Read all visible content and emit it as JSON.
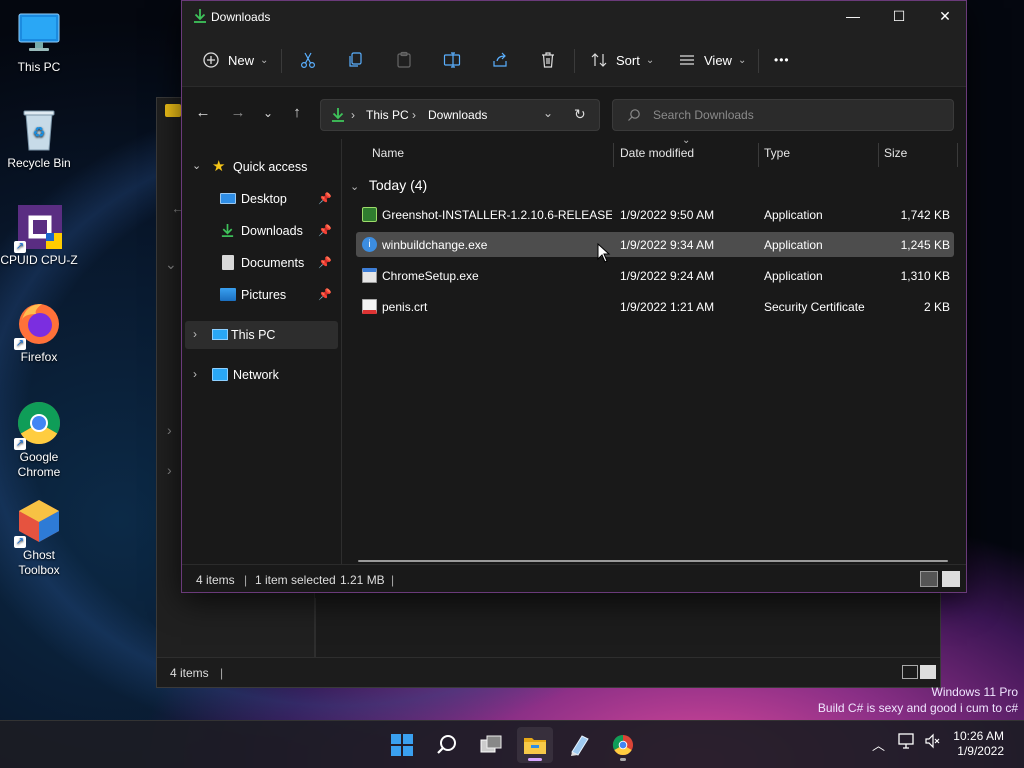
{
  "desktop": {
    "icons": [
      {
        "label": "This PC"
      },
      {
        "label": "Recycle Bin"
      },
      {
        "label": "CPUID CPU-Z"
      },
      {
        "label": "Firefox"
      },
      {
        "label": "Google Chrome"
      },
      {
        "label": "Ghost Toolbox"
      }
    ],
    "watermark": {
      "line1": "Windows 11 Pro",
      "line2": "Build C# is sexy and good i cum to c#"
    }
  },
  "background_window": {
    "status_text": "4 items"
  },
  "window": {
    "title": "Downloads",
    "controls": {
      "minimize": "—",
      "maximize": "☐",
      "close": "✕"
    },
    "toolbar": {
      "new_label": "New",
      "sort_label": "Sort",
      "view_label": "View",
      "more_label": "•••"
    },
    "address": {
      "segments": [
        "This PC",
        "Downloads"
      ],
      "separator": "›"
    },
    "search": {
      "placeholder": "Search Downloads"
    },
    "nav": {
      "quick_access": "Quick access",
      "items": [
        {
          "label": "Desktop"
        },
        {
          "label": "Downloads"
        },
        {
          "label": "Documents"
        },
        {
          "label": "Pictures"
        }
      ],
      "this_pc": "This PC",
      "network": "Network"
    },
    "columns": {
      "name": "Name",
      "date": "Date modified",
      "type": "Type",
      "size": "Size"
    },
    "group_label": "Today (4)",
    "files": [
      {
        "name": "Greenshot-INSTALLER-1.2.10.6-RELEASE....",
        "date": "1/9/2022 9:50 AM",
        "type": "Application",
        "size": "1,742 KB"
      },
      {
        "name": "winbuildchange.exe",
        "date": "1/9/2022 9:34 AM",
        "type": "Application",
        "size": "1,245 KB"
      },
      {
        "name": "ChromeSetup.exe",
        "date": "1/9/2022 9:24 AM",
        "type": "Application",
        "size": "1,310 KB"
      },
      {
        "name": "penis.crt",
        "date": "1/9/2022 1:21 AM",
        "type": "Security Certificate",
        "size": "2 KB"
      }
    ],
    "status": {
      "count": "4 items",
      "selected": "1 item selected",
      "selected_size": "1.21 MB"
    }
  },
  "taskbar": {
    "clock_time": "10:26 AM",
    "clock_date": "1/9/2022",
    "icons": [
      "windows-start-icon",
      "search-icon",
      "task-view-icon",
      "file-explorer-icon",
      "notepad-icon",
      "chrome-icon"
    ]
  },
  "colors": {
    "accent": "#0078d4",
    "selection": "#4d4d4d",
    "folder_yellow": "#f5c518",
    "window_border": "#6a3a7a"
  }
}
